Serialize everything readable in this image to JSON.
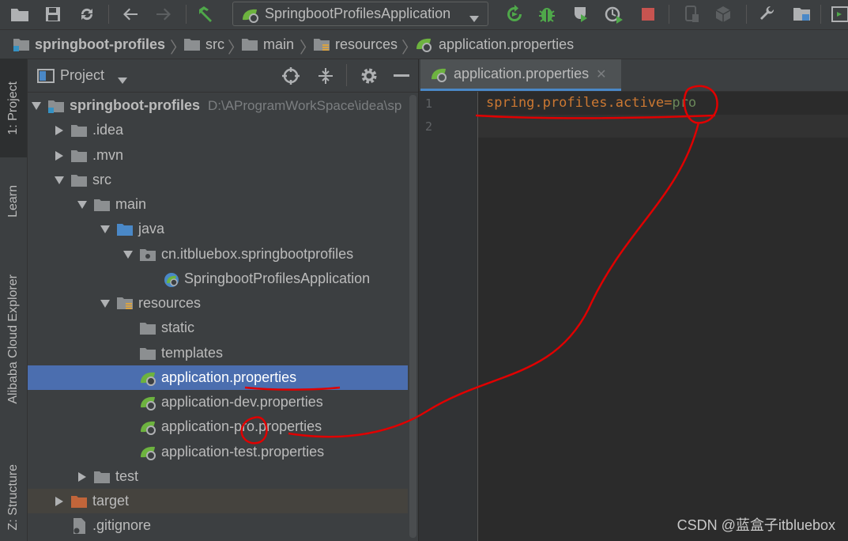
{
  "toolbar": {
    "run_config": "SpringbootProfilesApplication",
    "icons": [
      "open-folder-icon",
      "save-icon",
      "sync-icon",
      "back-icon",
      "forward-icon",
      "build-icon",
      "run-config-dropdown",
      "rerun-icon",
      "debug-icon",
      "coverage-icon",
      "profile-icon",
      "stop-icon",
      "device-icon",
      "sdk-icon",
      "settings-wrench-icon",
      "project-structure-icon",
      "terminal-icon"
    ]
  },
  "breadcrumb": {
    "items": [
      "springboot-profiles",
      "src",
      "main",
      "resources",
      "application.properties"
    ]
  },
  "side_tabs": {
    "project": "1: Project",
    "learn": "Learn",
    "cloud": "Alibaba Cloud Explorer",
    "structure": "Z: Structure"
  },
  "project_panel": {
    "title": "Project",
    "tree": [
      {
        "label": "springboot-profiles",
        "path": "D:\\AProgramWorkSpace\\idea\\sp",
        "depth": 0,
        "expanded": true,
        "icon": "module-folder"
      },
      {
        "label": ".idea",
        "depth": 1,
        "expanded": false,
        "icon": "folder"
      },
      {
        "label": ".mvn",
        "depth": 1,
        "expanded": false,
        "icon": "folder"
      },
      {
        "label": "src",
        "depth": 1,
        "expanded": true,
        "icon": "folder"
      },
      {
        "label": "main",
        "depth": 2,
        "expanded": true,
        "icon": "folder"
      },
      {
        "label": "java",
        "depth": 3,
        "expanded": true,
        "icon": "source-folder"
      },
      {
        "label": "cn.itbluebox.springbootprofiles",
        "depth": 4,
        "expanded": true,
        "icon": "package"
      },
      {
        "label": "SpringbootProfilesApplication",
        "depth": 5,
        "icon": "spring-class"
      },
      {
        "label": "resources",
        "depth": 3,
        "expanded": true,
        "icon": "resources-folder"
      },
      {
        "label": "static",
        "depth": 4,
        "icon": "folder"
      },
      {
        "label": "templates",
        "depth": 4,
        "icon": "folder"
      },
      {
        "label": "application.properties",
        "depth": 4,
        "icon": "spring-properties",
        "selected": true
      },
      {
        "label": "application-dev.properties",
        "depth": 4,
        "icon": "spring-properties"
      },
      {
        "label": "application-pro.properties",
        "depth": 4,
        "icon": "spring-properties"
      },
      {
        "label": "application-test.properties",
        "depth": 4,
        "icon": "spring-properties"
      },
      {
        "label": "test",
        "depth": 2,
        "expanded": false,
        "icon": "folder"
      },
      {
        "label": "target",
        "depth": 1,
        "expanded": false,
        "icon": "excluded-folder",
        "highlight": true
      },
      {
        "label": ".gitignore",
        "depth": 1,
        "icon": "gitignore-file"
      }
    ]
  },
  "editor": {
    "tab_label": "application.properties",
    "lines": [
      {
        "num": "1",
        "key": "spring.profiles.active",
        "eq": "=",
        "val": "pro"
      },
      {
        "num": "2",
        "key": "",
        "eq": "",
        "val": ""
      }
    ]
  },
  "watermark": "CSDN @蓝盒子itbluebox",
  "colors": {
    "bg": "#2b2b2b",
    "panel": "#3c3f41",
    "selection": "#4b6eaf",
    "spring_green": "#6db33f",
    "key_orange": "#cc7832",
    "value_green": "#6a8759",
    "annotation_red": "#e00000"
  }
}
